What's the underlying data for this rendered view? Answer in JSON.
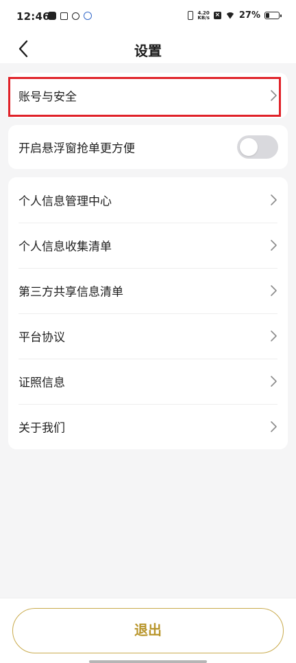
{
  "status_bar": {
    "time": "12:46",
    "net_speed_value": "4.20",
    "net_speed_unit": "KB/s",
    "battery_text": "27%",
    "battery_level_percent": 27,
    "left_icons": [
      "tiktok-icon",
      "inbox-icon",
      "link-icon",
      "app-notification-icon"
    ],
    "right_icons": [
      "vibrate-icon",
      "no-sim-icon",
      "wifi-icon",
      "battery-icon"
    ]
  },
  "header": {
    "title": "设置",
    "back_icon": "chevron-left-icon"
  },
  "settings": {
    "account_security_label": "账号与安全",
    "floating_window": {
      "label": "开启悬浮窗抢单更方便",
      "enabled": false
    },
    "list": [
      {
        "label": "个人信息管理中心"
      },
      {
        "label": "个人信息收集清单"
      },
      {
        "label": "第三方共享信息清单"
      },
      {
        "label": "平台协议"
      },
      {
        "label": "证照信息"
      },
      {
        "label": "关于我们"
      }
    ]
  },
  "footer": {
    "logout_label": "退出"
  },
  "colors": {
    "background": "#f5f5f6",
    "card": "#ffffff",
    "highlight_border": "#e02128",
    "logout_text": "#b8952b",
    "logout_border": "#c8a94a",
    "toggle_off": "#d9d9dd"
  }
}
